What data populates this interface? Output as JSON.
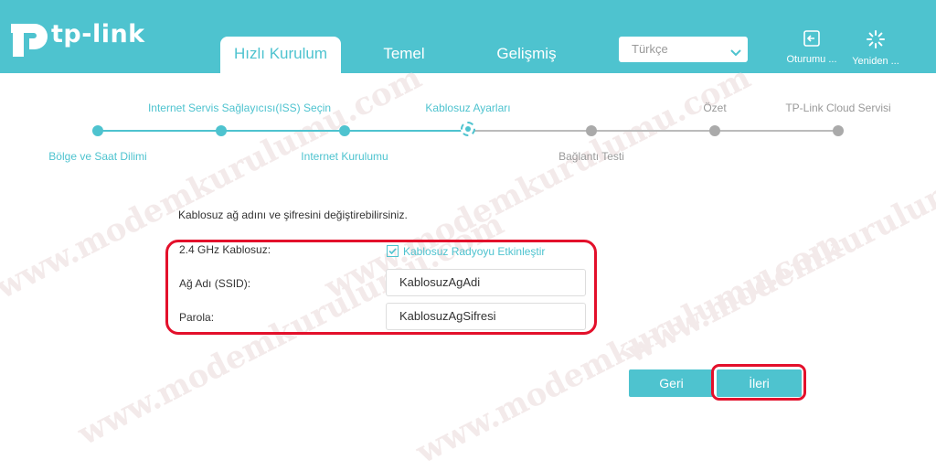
{
  "header": {
    "brand": "tp-link",
    "tabs": [
      {
        "label": "Hızlı Kurulum"
      },
      {
        "label": "Temel"
      },
      {
        "label": "Gelişmiş"
      }
    ],
    "language": "Türkçe",
    "logout_label": "Oturumu ...",
    "reboot_label": "Yeniden ..."
  },
  "watermark": "www.modemkurulumu.com",
  "stepper": {
    "steps": [
      {
        "label": "Bölge ve Saat Dilimi",
        "state": "done"
      },
      {
        "label": "Internet Servis Sağlayıcısı(ISS) Seçin",
        "state": "done"
      },
      {
        "label": "Internet Kurulumu",
        "state": "done"
      },
      {
        "label": "Kablosuz Ayarları",
        "state": "current"
      },
      {
        "label": "Bağlantı Testi",
        "state": "todo"
      },
      {
        "label": "Özet",
        "state": "todo"
      },
      {
        "label": "TP-Link Cloud Servisi",
        "state": "todo"
      }
    ]
  },
  "form": {
    "intro": "Kablosuz ağ adını ve şifresini değiştirebilirsiniz.",
    "band_label": "2.4 GHz Kablosuz:",
    "enable_label": "Kablosuz Radyoyu Etkinleştir",
    "enable_checked": true,
    "ssid_label": "Ağ Adı (SSID):",
    "ssid_value": "KablosuzAgAdi",
    "password_label": "Parola:",
    "password_value": "KablosuzAgSifresi"
  },
  "actions": {
    "back_label": "Geri",
    "next_label": "İleri"
  },
  "colors": {
    "accent": "#4ec3cf",
    "highlight": "#e3102b",
    "inactive": "#aaaaaa"
  }
}
